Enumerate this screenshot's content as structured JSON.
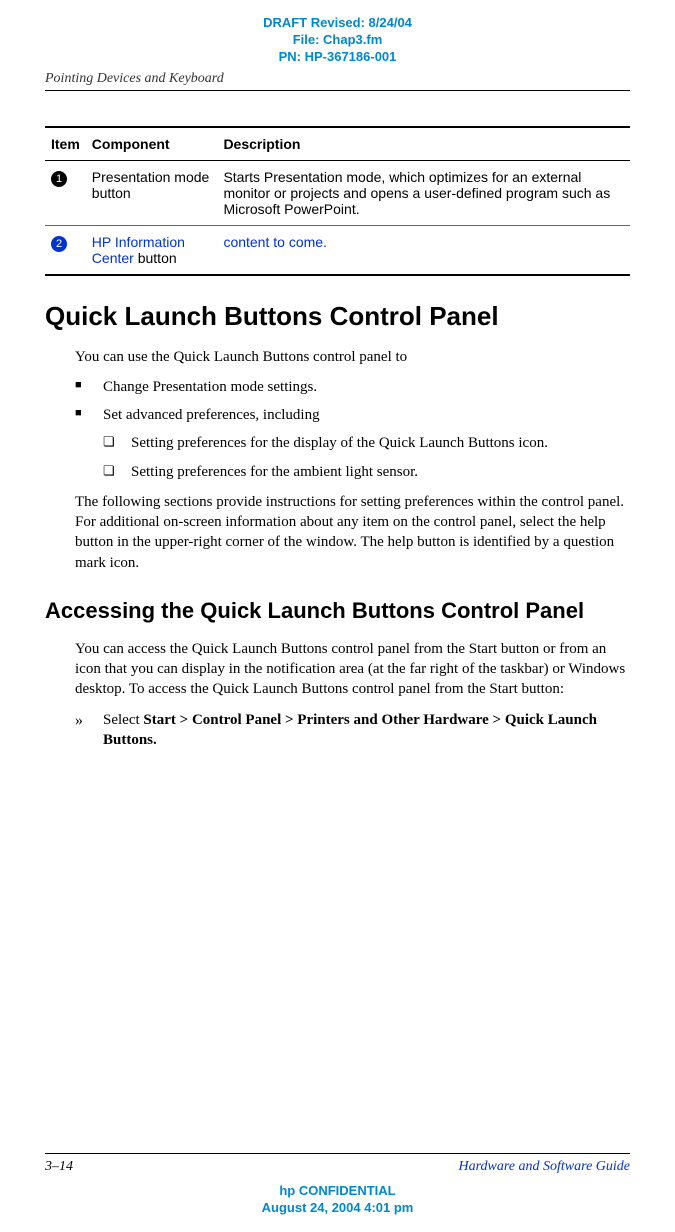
{
  "draft_header": {
    "line1": "DRAFT Revised: 8/24/04",
    "line2": "File: Chap3.fm",
    "line3": "PN: HP-367186-001"
  },
  "section_title_top": "Pointing Devices and Keyboard",
  "table": {
    "headers": {
      "item": "Item",
      "component": "Component",
      "description": "Description"
    },
    "rows": [
      {
        "item": "1",
        "component": "Presentation mode button",
        "description": "Starts Presentation mode, which optimizes for an external monitor or projects and opens a user-defined program such as Microsoft PowerPoint."
      },
      {
        "item": "2",
        "component_prefix": "HP Information Center",
        "component_suffix": " button",
        "description": "content to come."
      }
    ]
  },
  "heading1": "Quick Launch Buttons Control Panel",
  "para1": "You can use the Quick Launch Buttons control panel to",
  "bullets": [
    "Change Presentation mode settings.",
    "Set advanced preferences, including"
  ],
  "sub_bullets": [
    "Setting preferences for the display of the Quick Launch Buttons icon.",
    "Setting preferences for the ambient light sensor."
  ],
  "para2": "The following sections provide instructions for setting preferences within the control panel. For additional on-screen information about any item on the control panel, select the help button in the upper-right corner of the window. The help button is identified by a question mark icon.",
  "heading2": "Accessing the Quick Launch Buttons Control Panel",
  "para3": "You can access the Quick Launch Buttons control panel from the Start button or from an icon that you can display in the notification area (at the far right of the taskbar) or Windows desktop. To access the Quick Launch Buttons control panel from the Start button:",
  "arrow_prefix": "Select ",
  "arrow_bold": "Start > Control Panel > Printers and Other Hardware > Quick Launch Buttons.",
  "footer": {
    "page": "3–14",
    "guide": "Hardware and Software Guide",
    "conf1": "hp CONFIDENTIAL",
    "conf2": "August 24, 2004 4:01 pm"
  }
}
